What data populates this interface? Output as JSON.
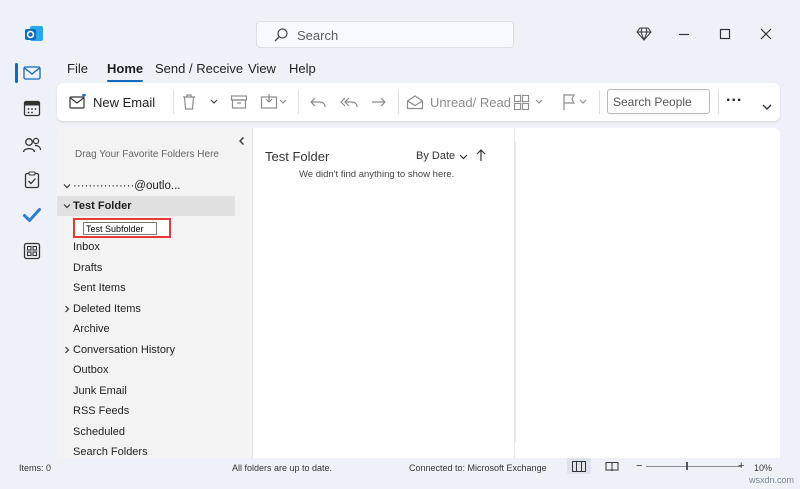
{
  "titlebar": {
    "search_placeholder": "Search",
    "icons": [
      "outlook-icon",
      "search-icon",
      "diamond-icon",
      "minimize-icon",
      "maximize-icon",
      "close-icon"
    ]
  },
  "nav_rail": [
    {
      "name": "mail",
      "icon": "mail-icon",
      "active": true
    },
    {
      "name": "calendar",
      "icon": "calendar-icon",
      "active": false
    },
    {
      "name": "people",
      "icon": "people-icon",
      "active": false
    },
    {
      "name": "tasks",
      "icon": "tasks-icon",
      "active": false
    },
    {
      "name": "todo",
      "icon": "todo-check-icon",
      "active": false
    },
    {
      "name": "apps",
      "icon": "apps-icon",
      "active": false
    }
  ],
  "menu": {
    "tabs": [
      "File",
      "Home",
      "Send / Receive",
      "View",
      "Help"
    ],
    "active": "Home"
  },
  "ribbon": {
    "new_email": "New Email",
    "unread_read": "Unread/ Read",
    "search_people_placeholder": "Search People",
    "more": "..."
  },
  "folder_pane": {
    "drag_hint": "Drag Your Favorite Folders Here",
    "account": "················@outlo...",
    "selected_folder": "Test Folder",
    "rename_value": "Test Subfolder",
    "folders": [
      {
        "label": "Inbox",
        "expandable": false
      },
      {
        "label": "Drafts",
        "expandable": false
      },
      {
        "label": "Sent Items",
        "expandable": false
      },
      {
        "label": "Deleted Items",
        "expandable": true
      },
      {
        "label": "Archive",
        "expandable": false
      },
      {
        "label": "Conversation History",
        "expandable": true
      },
      {
        "label": "Outbox",
        "expandable": false
      },
      {
        "label": "Junk Email",
        "expandable": false
      },
      {
        "label": "RSS Feeds",
        "expandable": false
      },
      {
        "label": "Scheduled",
        "expandable": false
      },
      {
        "label": "Search Folders",
        "expandable": false
      }
    ]
  },
  "message_list": {
    "title": "Test Folder",
    "sort_by": "By Date",
    "empty_message": "We didn't find anything to show here."
  },
  "status_bar": {
    "items": "Items: 0",
    "sync_status": "All folders are up to date.",
    "connection": "Connected to: Microsoft Exchange",
    "zoom": "10%",
    "zoom_level": 0.42
  },
  "watermark": "wsxdn.com",
  "colors": {
    "accent": "#0f6cbd",
    "highlight": "#e53935"
  }
}
